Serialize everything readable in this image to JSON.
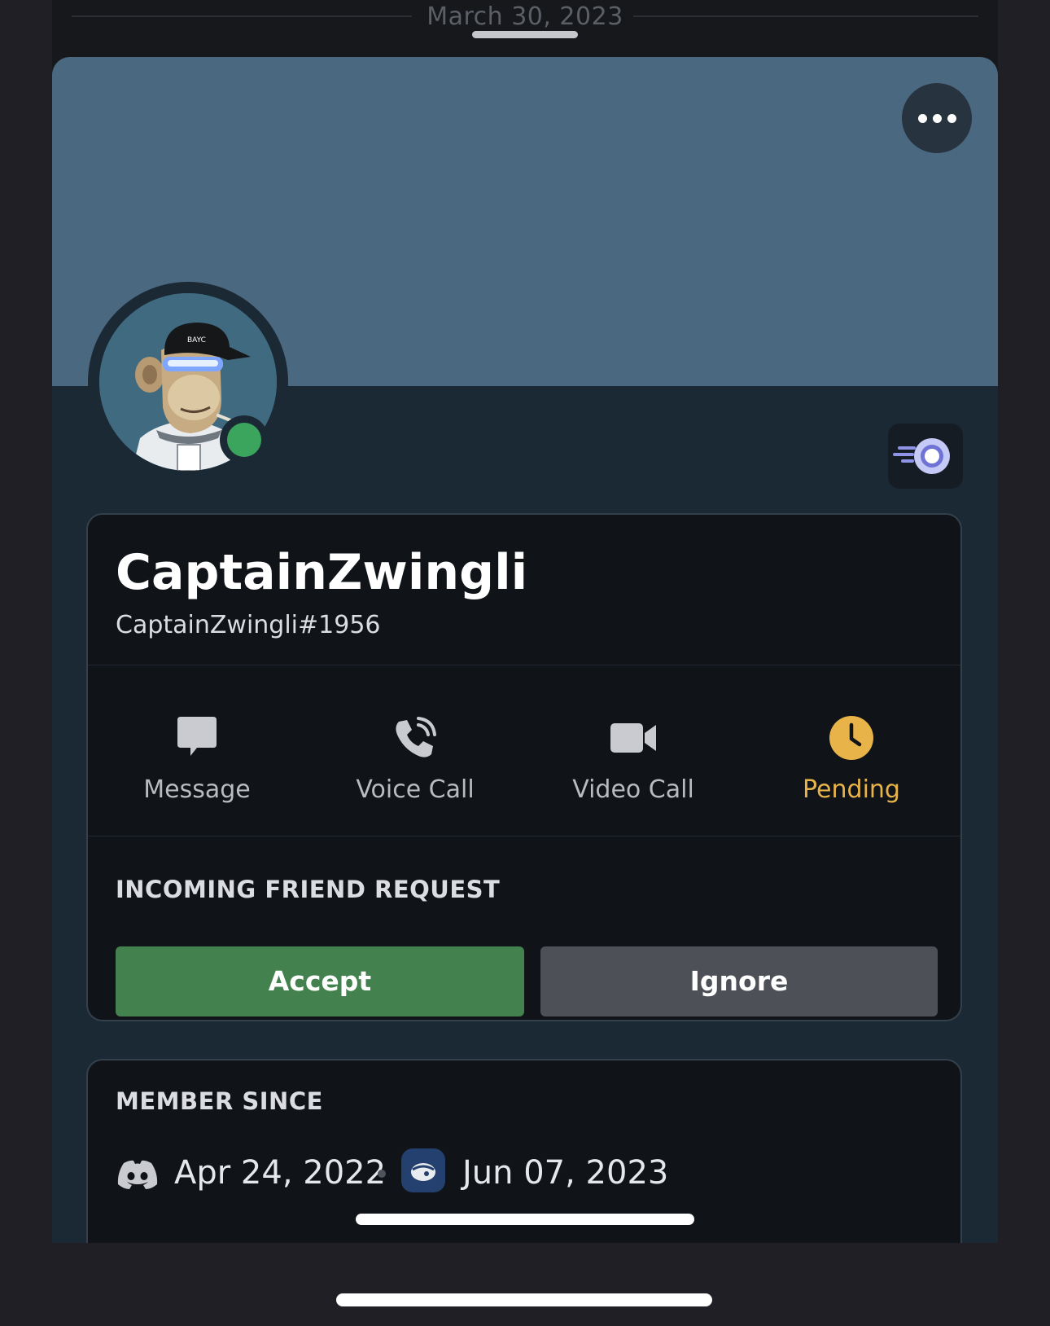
{
  "header": {
    "date_divider": "March 30, 2023"
  },
  "profile": {
    "display_name": "CaptainZwingli",
    "user_tag": "CaptainZwingli#1956",
    "status": "online",
    "avatar_cap_text": "BAYC"
  },
  "actions": [
    {
      "label": "Message",
      "icon": "message-icon"
    },
    {
      "label": "Voice Call",
      "icon": "voice-call-icon"
    },
    {
      "label": "Video Call",
      "icon": "video-call-icon"
    },
    {
      "label": "Pending",
      "icon": "clock-icon"
    }
  ],
  "friend_request": {
    "title": "INCOMING FRIEND REQUEST",
    "accept_label": "Accept",
    "ignore_label": "Ignore"
  },
  "member_since": {
    "title": "MEMBER SINCE",
    "discord_date": "Apr 24, 2022",
    "server_date": "Jun 07, 2023"
  },
  "colors": {
    "banner": "#4a6880",
    "online": "#3ba55d",
    "pending": "#e8b449",
    "accept": "#43814e",
    "ignore": "#4e5058"
  }
}
